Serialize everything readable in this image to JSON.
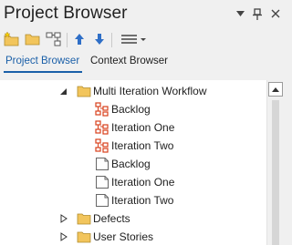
{
  "window": {
    "title": "Project Browser"
  },
  "tabs": [
    {
      "label": "Project Browser",
      "active": true
    },
    {
      "label": "Context Browser",
      "active": false
    }
  ],
  "tree": {
    "root": {
      "label": "Multi Iteration Workflow",
      "state": "expanded"
    },
    "children": [
      {
        "label": "Backlog",
        "icon": "kanban-diagram-icon"
      },
      {
        "label": "Iteration One",
        "icon": "kanban-diagram-icon"
      },
      {
        "label": "Iteration Two",
        "icon": "kanban-diagram-icon"
      },
      {
        "label": "Backlog",
        "icon": "blank-diagram-icon"
      },
      {
        "label": "Iteration One",
        "icon": "blank-diagram-icon"
      },
      {
        "label": "Iteration Two",
        "icon": "blank-diagram-icon"
      }
    ],
    "siblings": [
      {
        "label": "Defects",
        "icon": "folder-icon",
        "state": "collapsed"
      },
      {
        "label": "User Stories",
        "icon": "folder-icon",
        "state": "collapsed"
      }
    ]
  },
  "colors": {
    "accent": "#1a5fa8",
    "folder": "#f2c55c",
    "kanban": "#d8401c",
    "panel": "#f0f0f0",
    "tree_bg": "#ffffff"
  }
}
